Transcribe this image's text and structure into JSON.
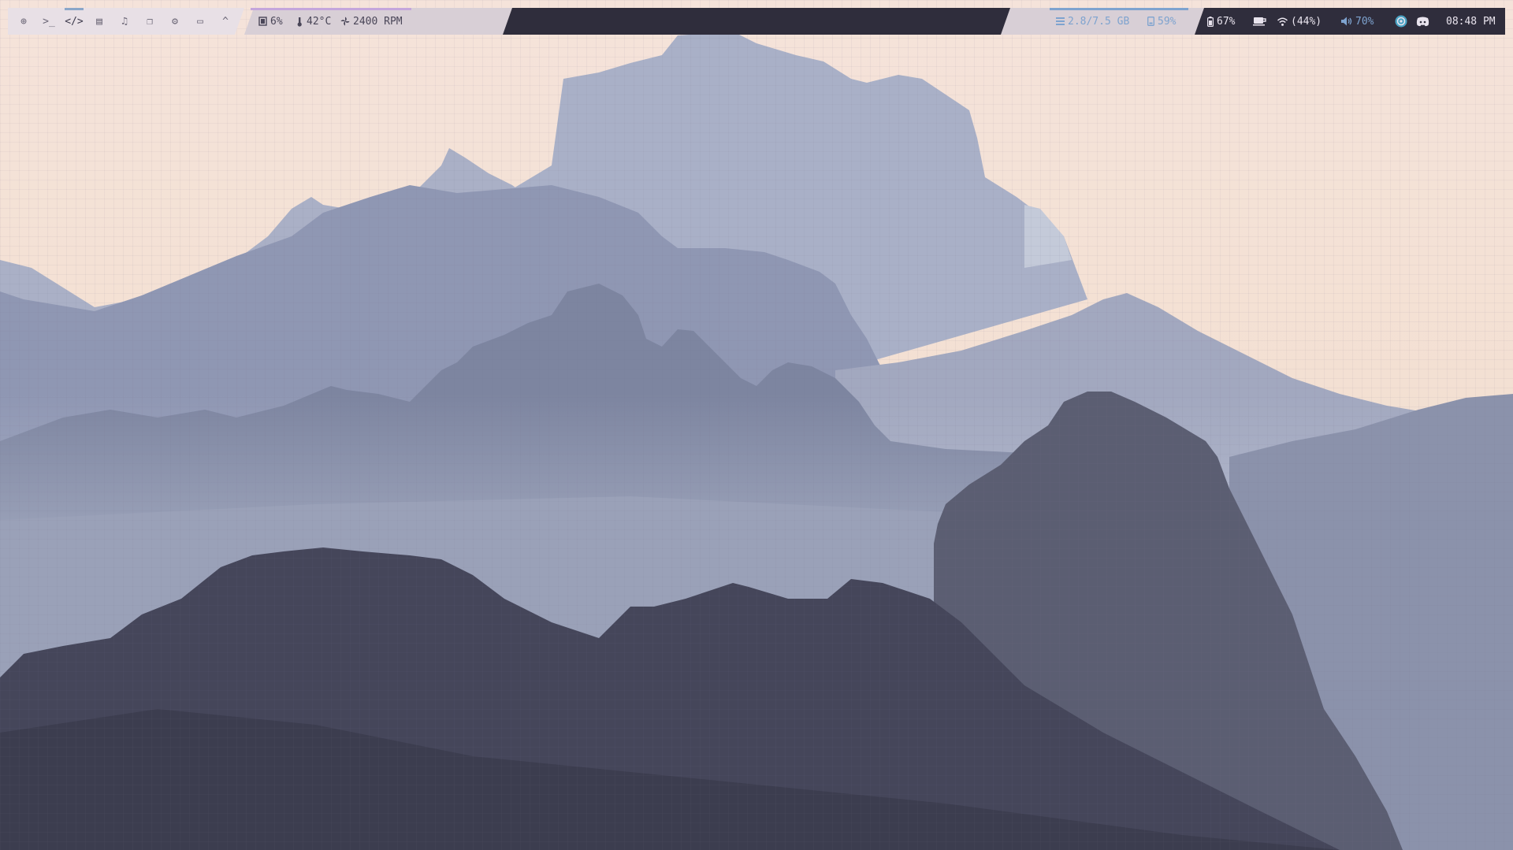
{
  "workspaces": [
    {
      "icon": "globe-icon",
      "glyph": "⊕"
    },
    {
      "icon": "terminal-icon",
      "glyph": ">_"
    },
    {
      "icon": "code-icon",
      "glyph": "</>"
    },
    {
      "icon": "chat-icon",
      "glyph": "▤"
    },
    {
      "icon": "music-icon",
      "glyph": "♫"
    },
    {
      "icon": "copy-icon",
      "glyph": "❐"
    },
    {
      "icon": "settings-icon",
      "glyph": "⚙"
    },
    {
      "icon": "notes-icon",
      "glyph": "▭"
    },
    {
      "icon": "chevron-up-icon",
      "glyph": "^"
    }
  ],
  "system": {
    "cpu": "6%",
    "temperature": "42°C",
    "fan": "2400 RPM"
  },
  "memory": {
    "ram": "2.8/7.5 GB",
    "disk": "59%"
  },
  "status": {
    "battery": "67%",
    "wifi": "(44%)",
    "volume": "70%",
    "clock": "08:48 PM"
  },
  "colors": {
    "sky": "#f3e2d8",
    "bar_dark": "#2f2d3c",
    "bar_light": "#e8e0e6",
    "accent_blue": "#7ea3cf",
    "accent_purple": "#c4a6dc"
  }
}
